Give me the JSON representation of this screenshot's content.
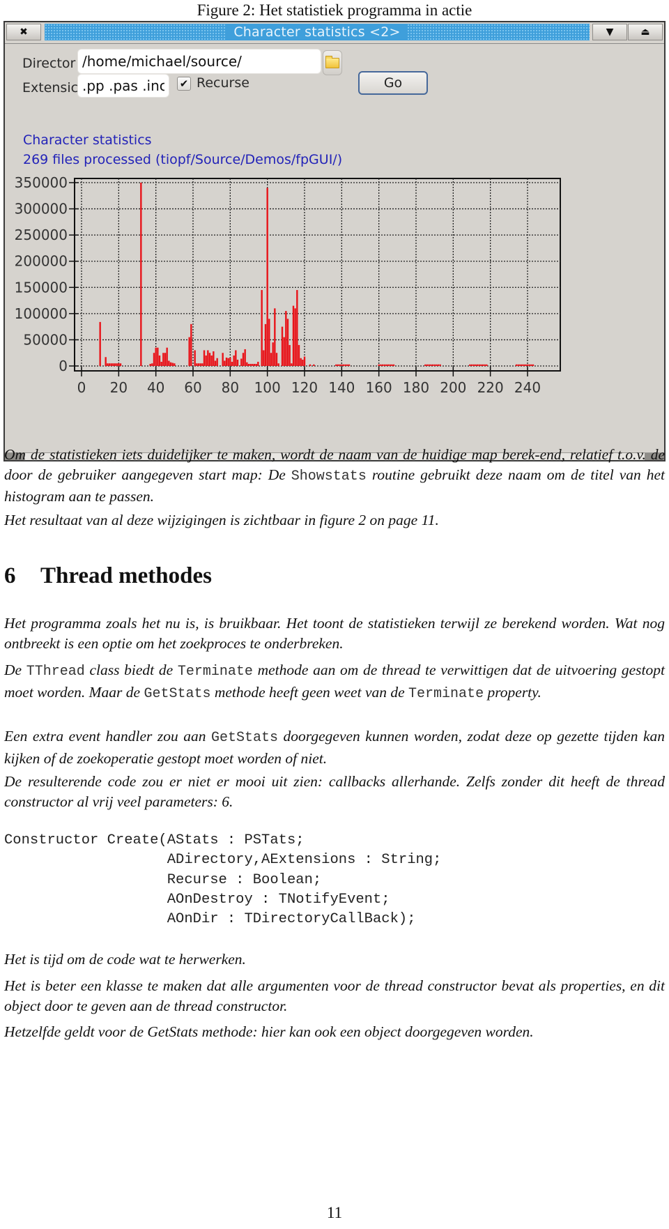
{
  "caption": "Figure 2: Het statistiek programma in actie",
  "window": {
    "title": "Character statistics <2>",
    "close_icon": "x-icon",
    "minimize_icon": "shade-down-icon",
    "maximize_icon": "eject-up-icon",
    "directory_label": "Director",
    "directory_value": "/home/michael/source/",
    "extensions_label": "Extensic",
    "extensions_value": ".pp .pas .inc",
    "recurse_label": "Recurse",
    "recurse_checked": true,
    "check_glyph": "✔",
    "go_label": "Go",
    "folder_icon": "folder-icon"
  },
  "chart_data": {
    "type": "bar",
    "title": "Character statistics",
    "subtitle": "269 files processed (tiopf/Source/Demos/fpGUI/)",
    "xlabel": "",
    "ylabel": "",
    "xlim": [
      -2,
      257
    ],
    "ylim": [
      0,
      350000
    ],
    "xticks": [
      0,
      20,
      40,
      60,
      80,
      100,
      120,
      140,
      160,
      180,
      200,
      220,
      240
    ],
    "yticks": [
      0,
      50000,
      100000,
      150000,
      200000,
      250000,
      300000,
      350000
    ],
    "grid": true,
    "bar_color": "#e8141a",
    "points": [
      [
        10,
        84000
      ],
      [
        13,
        17000
      ],
      [
        14,
        5000
      ],
      [
        15,
        5000
      ],
      [
        16,
        5000
      ],
      [
        17,
        5000
      ],
      [
        18,
        5000
      ],
      [
        19,
        5000
      ],
      [
        20,
        5000
      ],
      [
        21,
        5000
      ],
      [
        32,
        350000
      ],
      [
        37,
        4000
      ],
      [
        38,
        5000
      ],
      [
        39,
        25000
      ],
      [
        40,
        35000
      ],
      [
        41,
        35000
      ],
      [
        42,
        20000
      ],
      [
        43,
        8000
      ],
      [
        44,
        25000
      ],
      [
        45,
        25000
      ],
      [
        46,
        35000
      ],
      [
        47,
        10000
      ],
      [
        48,
        7000
      ],
      [
        49,
        6000
      ],
      [
        50,
        5000
      ],
      [
        58,
        55000
      ],
      [
        59,
        80000
      ],
      [
        61,
        30000
      ],
      [
        62,
        5000
      ],
      [
        63,
        5000
      ],
      [
        64,
        5000
      ],
      [
        65,
        5000
      ],
      [
        66,
        30000
      ],
      [
        67,
        20000
      ],
      [
        68,
        30000
      ],
      [
        69,
        25000
      ],
      [
        70,
        20000
      ],
      [
        71,
        28000
      ],
      [
        72,
        10000
      ],
      [
        73,
        15000
      ],
      [
        76,
        25000
      ],
      [
        77,
        10000
      ],
      [
        78,
        16000
      ],
      [
        79,
        15000
      ],
      [
        80,
        16000
      ],
      [
        81,
        8000
      ],
      [
        82,
        20000
      ],
      [
        83,
        30000
      ],
      [
        84,
        12000
      ],
      [
        86,
        14000
      ],
      [
        87,
        25000
      ],
      [
        88,
        32000
      ],
      [
        89,
        7000
      ],
      [
        90,
        4000
      ],
      [
        91,
        4000
      ],
      [
        92,
        4000
      ],
      [
        93,
        4000
      ],
      [
        94,
        4000
      ],
      [
        95,
        8000
      ],
      [
        97,
        145000
      ],
      [
        98,
        30000
      ],
      [
        99,
        80000
      ],
      [
        100,
        340000
      ],
      [
        101,
        90000
      ],
      [
        102,
        25000
      ],
      [
        103,
        45000
      ],
      [
        104,
        110000
      ],
      [
        105,
        25000
      ],
      [
        106,
        5000
      ],
      [
        108,
        75000
      ],
      [
        109,
        55000
      ],
      [
        110,
        105000
      ],
      [
        111,
        90000
      ],
      [
        112,
        40000
      ],
      [
        113,
        5000
      ],
      [
        114,
        115000
      ],
      [
        115,
        110000
      ],
      [
        116,
        145000
      ],
      [
        117,
        40000
      ],
      [
        118,
        15000
      ],
      [
        119,
        12000
      ],
      [
        120,
        18000
      ],
      [
        123,
        3000
      ],
      [
        125,
        3000
      ],
      [
        137,
        3000
      ],
      [
        138,
        3000
      ],
      [
        139,
        3000
      ],
      [
        140,
        3000
      ],
      [
        141,
        3000
      ],
      [
        142,
        3000
      ],
      [
        143,
        3000
      ],
      [
        144,
        3000
      ],
      [
        160,
        3000
      ],
      [
        161,
        3000
      ],
      [
        162,
        3000
      ],
      [
        163,
        3000
      ],
      [
        164,
        3000
      ],
      [
        165,
        3000
      ],
      [
        166,
        3000
      ],
      [
        167,
        3000
      ],
      [
        168,
        3000
      ],
      [
        185,
        3000
      ],
      [
        186,
        3000
      ],
      [
        187,
        3000
      ],
      [
        188,
        3000
      ],
      [
        189,
        3000
      ],
      [
        190,
        3000
      ],
      [
        191,
        3000
      ],
      [
        192,
        3000
      ],
      [
        193,
        3000
      ],
      [
        209,
        3000
      ],
      [
        210,
        3000
      ],
      [
        211,
        3000
      ],
      [
        212,
        3000
      ],
      [
        213,
        3000
      ],
      [
        214,
        3000
      ],
      [
        215,
        3000
      ],
      [
        216,
        3000
      ],
      [
        217,
        3000
      ],
      [
        218,
        3000
      ],
      [
        234,
        3000
      ],
      [
        235,
        3000
      ],
      [
        236,
        3000
      ],
      [
        237,
        3000
      ],
      [
        238,
        3000
      ],
      [
        239,
        3000
      ],
      [
        240,
        3000
      ],
      [
        241,
        3000
      ],
      [
        242,
        3000
      ],
      [
        243,
        3000
      ]
    ]
  },
  "text": {
    "p1_a": "Om de statistieken iets duidelijker te maken, wordt de naam van de huidige map berek-end, relatief t.o.v. de door de gebruiker aangegeven start map: De ",
    "p1_code": "Showstats",
    "p1_b": " routine gebruikt deze naam om de titel van het histogram aan te passen.",
    "p2": "Het resultaat van al deze wijzigingen is zichtbaar in figure 2 on page 11.",
    "section_number": "6",
    "section_title": "Thread methodes",
    "p3": "Het programma zoals het nu is, is bruikbaar. Het toont de statistieken terwijl ze berekend worden. Wat nog ontbreekt is een optie om het zoekproces te onderbreken.",
    "p4_a": "De ",
    "p4_code1": "TThread",
    "p4_b": " class biedt de ",
    "p4_code2": "Terminate",
    "p4_c": " methode aan om de thread te verwittigen dat de uitvoering gestopt moet worden. Maar de ",
    "p4_code3": "GetStats",
    "p4_d": " methode heeft geen weet van de ",
    "p4_code4": "Terminate",
    "p4_e": " property.",
    "p5_a": "Een extra event handler zou aan ",
    "p5_code": "GetStats",
    "p5_b": " doorgegeven kunnen worden, zodat deze op gezette tijden kan kijken of de zoekoperatie gestopt moet worden of niet.",
    "p6": "De resulterende code zou er niet er mooi uit zien: callbacks allerhande. Zelfs zonder dit heeft de thread constructor al vrij veel parameters: 6.",
    "code": "Constructor Create(AStats : PSTats;\n                   ADirectory,AExtensions : String;\n                   Recurse : Boolean;\n                   AOnDestroy : TNotifyEvent;\n                   AOnDir : TDirectoryCallBack);",
    "p7": "Het is tijd om de code wat te herwerken.",
    "p8": "Het is beter een klasse te maken dat alle argumenten voor de thread constructor bevat als properties, en dit object door te geven aan de thread constructor.",
    "p9": "Hetzelfde geldt voor de GetStats methode: hier kan ook een object doorgegeven worden.",
    "page_number": "11"
  }
}
